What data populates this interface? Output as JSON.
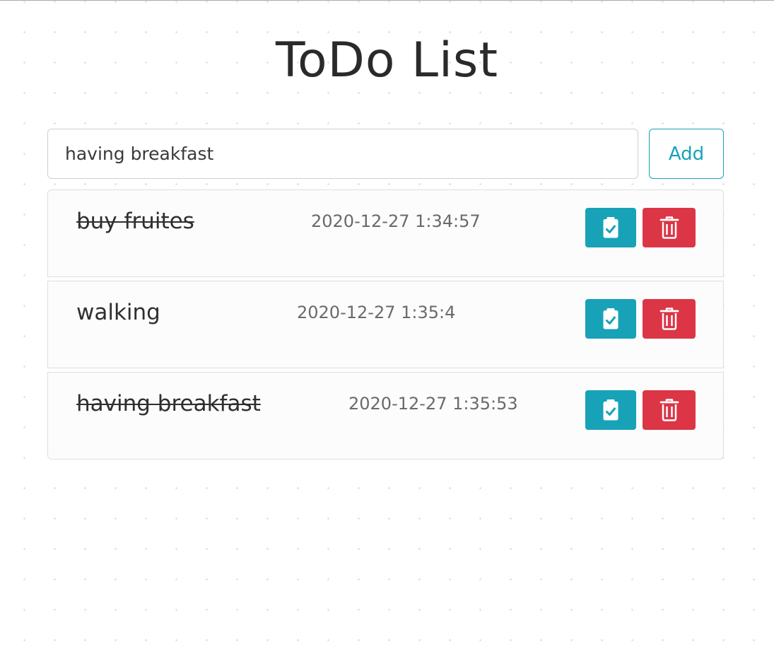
{
  "page": {
    "title": "ToDo List"
  },
  "form": {
    "input_value": "having breakfast",
    "add_label": "Add"
  },
  "colors": {
    "accent": "#17a2b8",
    "danger": "#dc3545"
  },
  "todos": [
    {
      "text": "buy fruites",
      "time": "2020-12-27 1:34:57",
      "completed": true,
      "complete_icon": "clipboard-check-icon",
      "delete_icon": "trash-icon"
    },
    {
      "text": "walking",
      "time": "2020-12-27 1:35:4",
      "completed": false,
      "complete_icon": "clipboard-check-icon",
      "delete_icon": "trash-icon"
    },
    {
      "text": "having breakfast",
      "time": "2020-12-27 1:35:53",
      "completed": true,
      "complete_icon": "clipboard-check-icon",
      "delete_icon": "trash-icon"
    }
  ]
}
